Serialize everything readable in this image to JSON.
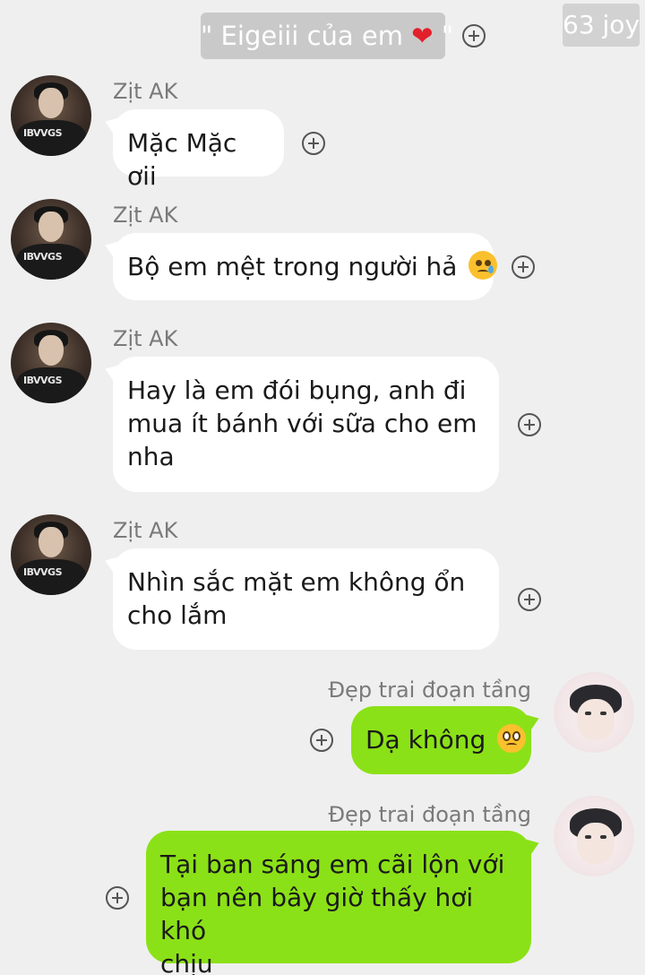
{
  "header": {
    "title_prefix": "\" Eigeiii của em",
    "title_suffix": " \"",
    "watermark": "63 joy"
  },
  "messages": [
    {
      "sender": "Zịt AK",
      "text": "Mặc Mặc ơii",
      "emoji": ""
    },
    {
      "sender": "Zịt AK",
      "text": "Bộ em mệt trong người hả",
      "emoji": "crying-face"
    },
    {
      "sender": "Zịt AK",
      "lines": [
        "Hay là em đói bụng, anh đi",
        "mua ít bánh với sữa cho em",
        "nha"
      ]
    },
    {
      "sender": "Zịt AK",
      "lines": [
        "Nhìn sắc mặt em không ổn",
        "cho lắm"
      ]
    },
    {
      "sender": "Đẹp trai đoạn tầng",
      "text": "Dạ không",
      "emoji": "pleading-face"
    },
    {
      "sender": "Đẹp trai đoạn tầng",
      "lines": [
        "Tại ban sáng em cãi lộn với",
        "bạn nên bây giờ thấy hơi khó",
        "chịu"
      ]
    }
  ],
  "colors": {
    "background": "#efefef",
    "incoming_bubble": "#ffffff",
    "outgoing_bubble": "#8be117",
    "sender_text": "#7a7a7a",
    "chip": "#c9c9c9"
  }
}
